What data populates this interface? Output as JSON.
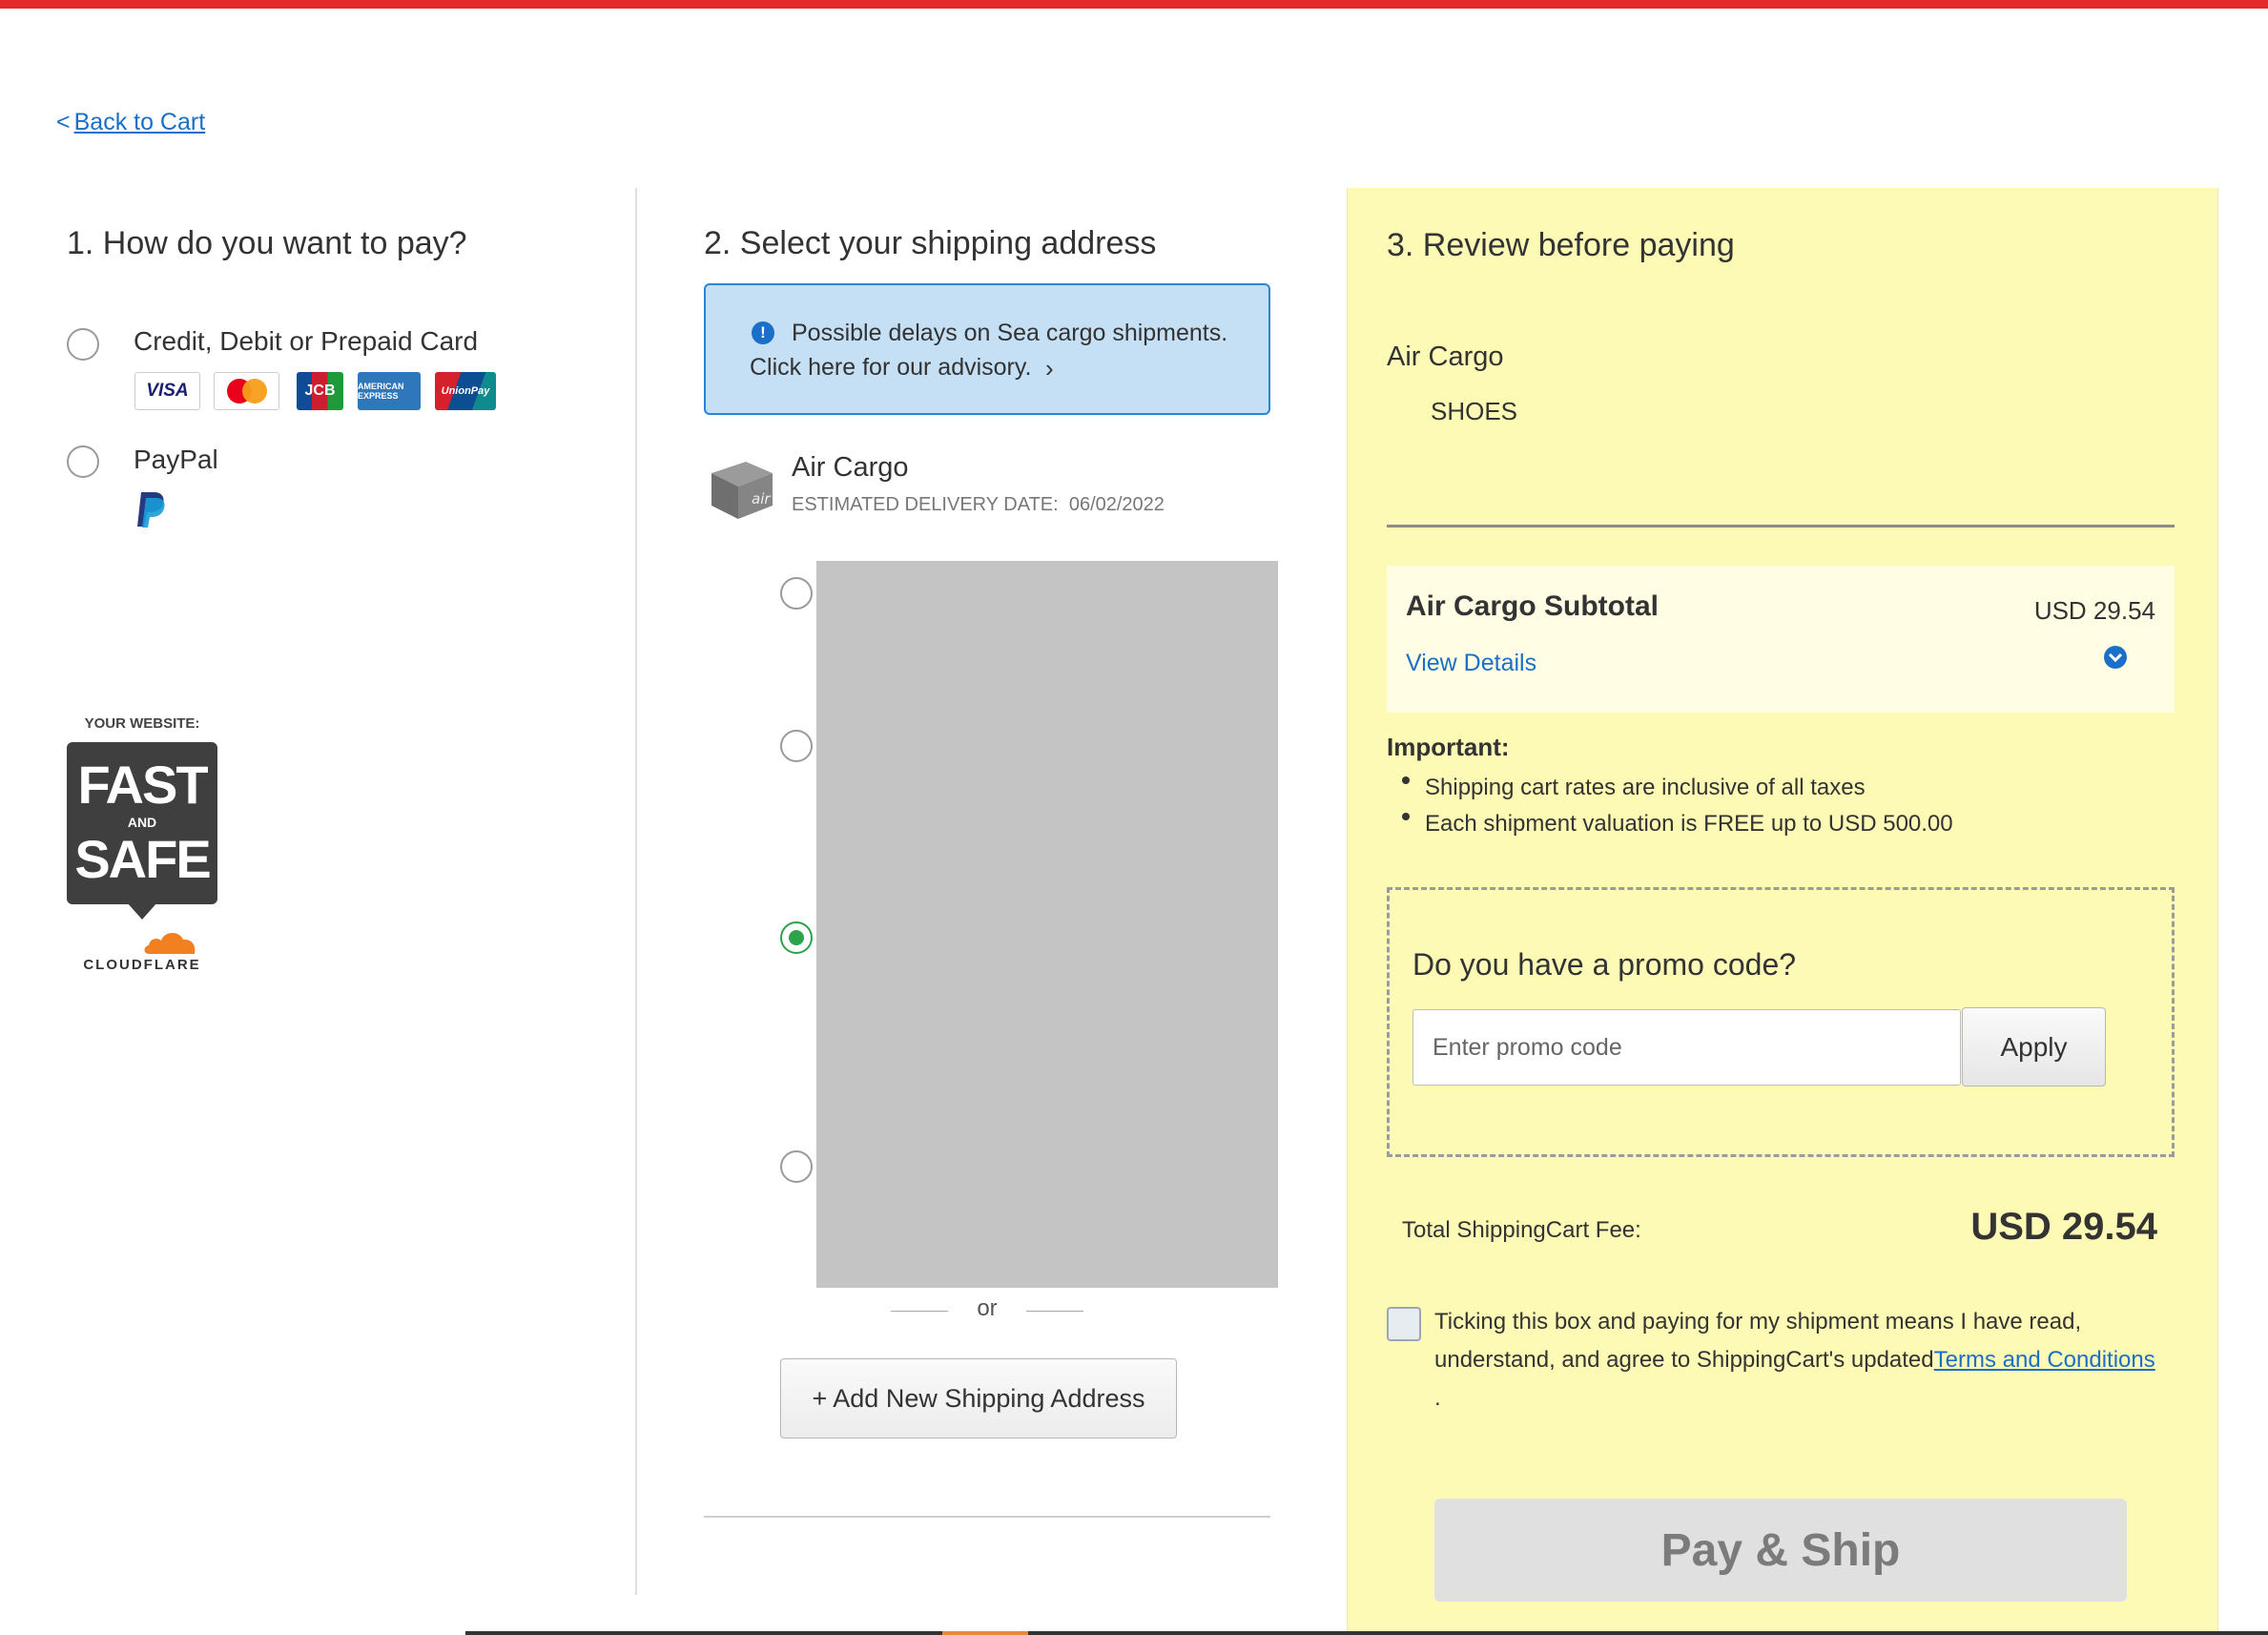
{
  "nav": {
    "back_label": "Back to Cart",
    "back_chevron": "<"
  },
  "payment": {
    "heading": "1. How do you want to pay?",
    "options": [
      {
        "label": "Credit, Debit or Prepaid Card",
        "selected": false
      },
      {
        "label": "PayPal",
        "selected": false
      }
    ],
    "cards": [
      {
        "name": "visa-icon",
        "text": "VISA"
      },
      {
        "name": "mastercard-icon",
        "text": ""
      },
      {
        "name": "jcb-icon",
        "text": "JCB"
      },
      {
        "name": "amex-icon",
        "text": "AMERICAN EXPRESS"
      },
      {
        "name": "unionpay-icon",
        "text": "UnionPay"
      }
    ],
    "badge": {
      "top": "YOUR WEBSITE:",
      "big1": "FAST",
      "mid": "AND",
      "big2": "SAFE",
      "brand": "CLOUDFLARE"
    }
  },
  "shipping": {
    "heading": "2. Select your shipping address",
    "alert_line1": "Possible delays on Sea cargo shipments.",
    "alert_line2": "Click here for our advisory.",
    "method": "Air Cargo",
    "delivery_label": "ESTIMATED DELIVERY DATE:",
    "delivery_date": "06/02/2022",
    "or_text": "or",
    "add_button": "+ Add New Shipping Address"
  },
  "review": {
    "heading": "3. Review before paying",
    "method": "Air Cargo",
    "item": "SHOES",
    "subtotal_label": "Air Cargo Subtotal",
    "subtotal_value": "USD 29.54",
    "view_details": "View Details",
    "important_title": "Important:",
    "important_items": [
      "Shipping cart rates are inclusive of all taxes",
      "Each shipment valuation is FREE up to USD 500.00"
    ],
    "promo_title": "Do you have a promo code?",
    "promo_placeholder": "Enter promo code",
    "apply_label": "Apply",
    "total_label": "Total ShippingCart Fee:",
    "total_value": "USD 29.54",
    "terms_line1": "Ticking this box and paying for my shipment means I have read,",
    "terms_line2": "understand, and agree to ShippingCart's updated",
    "terms_link": "Terms and Conditions",
    "terms_end": ".",
    "pay_label": "Pay & Ship"
  },
  "colors": {
    "accent_red": "#e32b2b",
    "link_blue": "#1a6fc9",
    "review_bg": "#fdfab6",
    "selected_green": "#2ca24a"
  }
}
